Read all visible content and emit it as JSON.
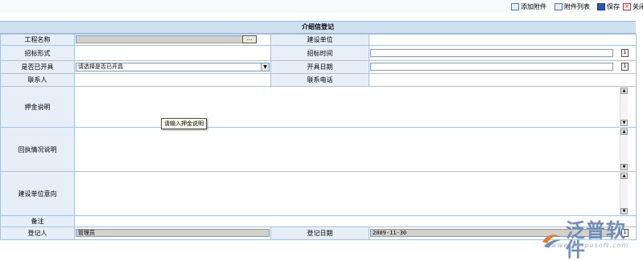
{
  "toolbar": {
    "add_attachment": "添加附件",
    "attachment_list": "附件列表",
    "save": "保存",
    "close": "关闭"
  },
  "form": {
    "title": "介绍信登记",
    "project_name_label": "工程名称",
    "project_name_value": "",
    "browse_label": "...",
    "build_unit_label": "建设单位",
    "bid_form_label": "招标形式",
    "bid_time_label": "招标时间",
    "calendar_label": "1",
    "issued_label": "是否已开具",
    "issued_select_value": "请选择是否已开具",
    "issue_date_label": "开具日期",
    "contact_label": "联系人",
    "phone_label": "联系电话",
    "deposit_label": "押金说明",
    "deposit_tooltip": "请输入押金说明",
    "return_label": "回执情况说明",
    "intent_label": "建设单位意向",
    "remark_label": "备注",
    "registrar_label": "登记人",
    "registrar_value": "管理员",
    "reg_date_label": "登记日期",
    "reg_date_value": "2009-11-30"
  },
  "brand": {
    "name": "泛普软件",
    "url": "www.fanpusoft.com"
  }
}
